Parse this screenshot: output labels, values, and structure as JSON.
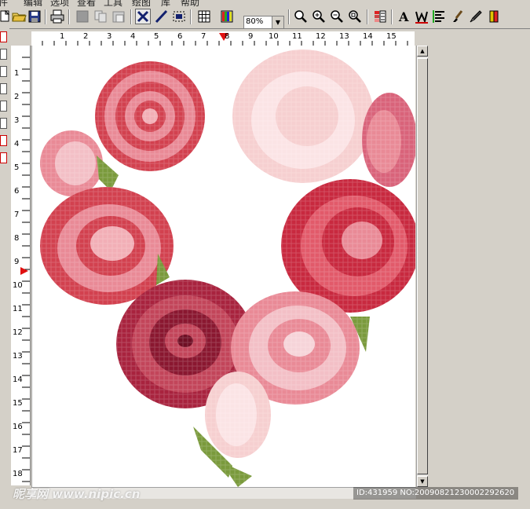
{
  "menubar": {
    "items": [
      "件",
      "编辑",
      "选项",
      "查看",
      "工具",
      "绘图",
      "库",
      "帮助"
    ]
  },
  "toolbar": {
    "buttons": [
      {
        "name": "new-file-icon"
      },
      {
        "name": "open-folder-icon"
      },
      {
        "name": "save-icon"
      },
      {
        "name": "print-icon"
      },
      {
        "name": "cut-icon"
      },
      {
        "name": "copy-icon"
      },
      {
        "name": "paste-icon"
      },
      {
        "name": "cross-stitch-icon"
      },
      {
        "name": "backstitch-icon"
      },
      {
        "name": "select-icon"
      },
      {
        "name": "grid-icon"
      },
      {
        "name": "palette-icon"
      },
      {
        "name": "zoom-icon"
      },
      {
        "name": "zoom-in-icon"
      },
      {
        "name": "zoom-out-icon"
      },
      {
        "name": "zoom-fit-icon"
      },
      {
        "name": "color-chart-icon"
      },
      {
        "name": "text-icon"
      },
      {
        "name": "stitch-w-icon"
      },
      {
        "name": "align-icon"
      },
      {
        "name": "brush-icon"
      },
      {
        "name": "eyedropper-icon"
      },
      {
        "name": "thread-color-icon"
      }
    ],
    "zoom": {
      "value": "80%"
    }
  },
  "ruler": {
    "h_labels": [
      "1",
      "2",
      "3",
      "4",
      "5",
      "6",
      "7",
      "8",
      "9",
      "10",
      "11",
      "12",
      "13",
      "14",
      "15"
    ],
    "v_labels": [
      "1",
      "2",
      "3",
      "4",
      "5",
      "6",
      "7",
      "8",
      "9",
      "10",
      "11",
      "12",
      "13",
      "14",
      "15",
      "16",
      "17",
      "18"
    ]
  },
  "watermark": {
    "text": "昵享网 www.nipic.cn",
    "id_text": "ID:431959 NO:20090821230002292620"
  },
  "colors": {
    "rose_light": "#f6cfd0",
    "rose_pink": "#e98a96",
    "rose_red": "#d2414f",
    "rose_deep": "#a8233e",
    "leaf": "#7a9a3c"
  }
}
